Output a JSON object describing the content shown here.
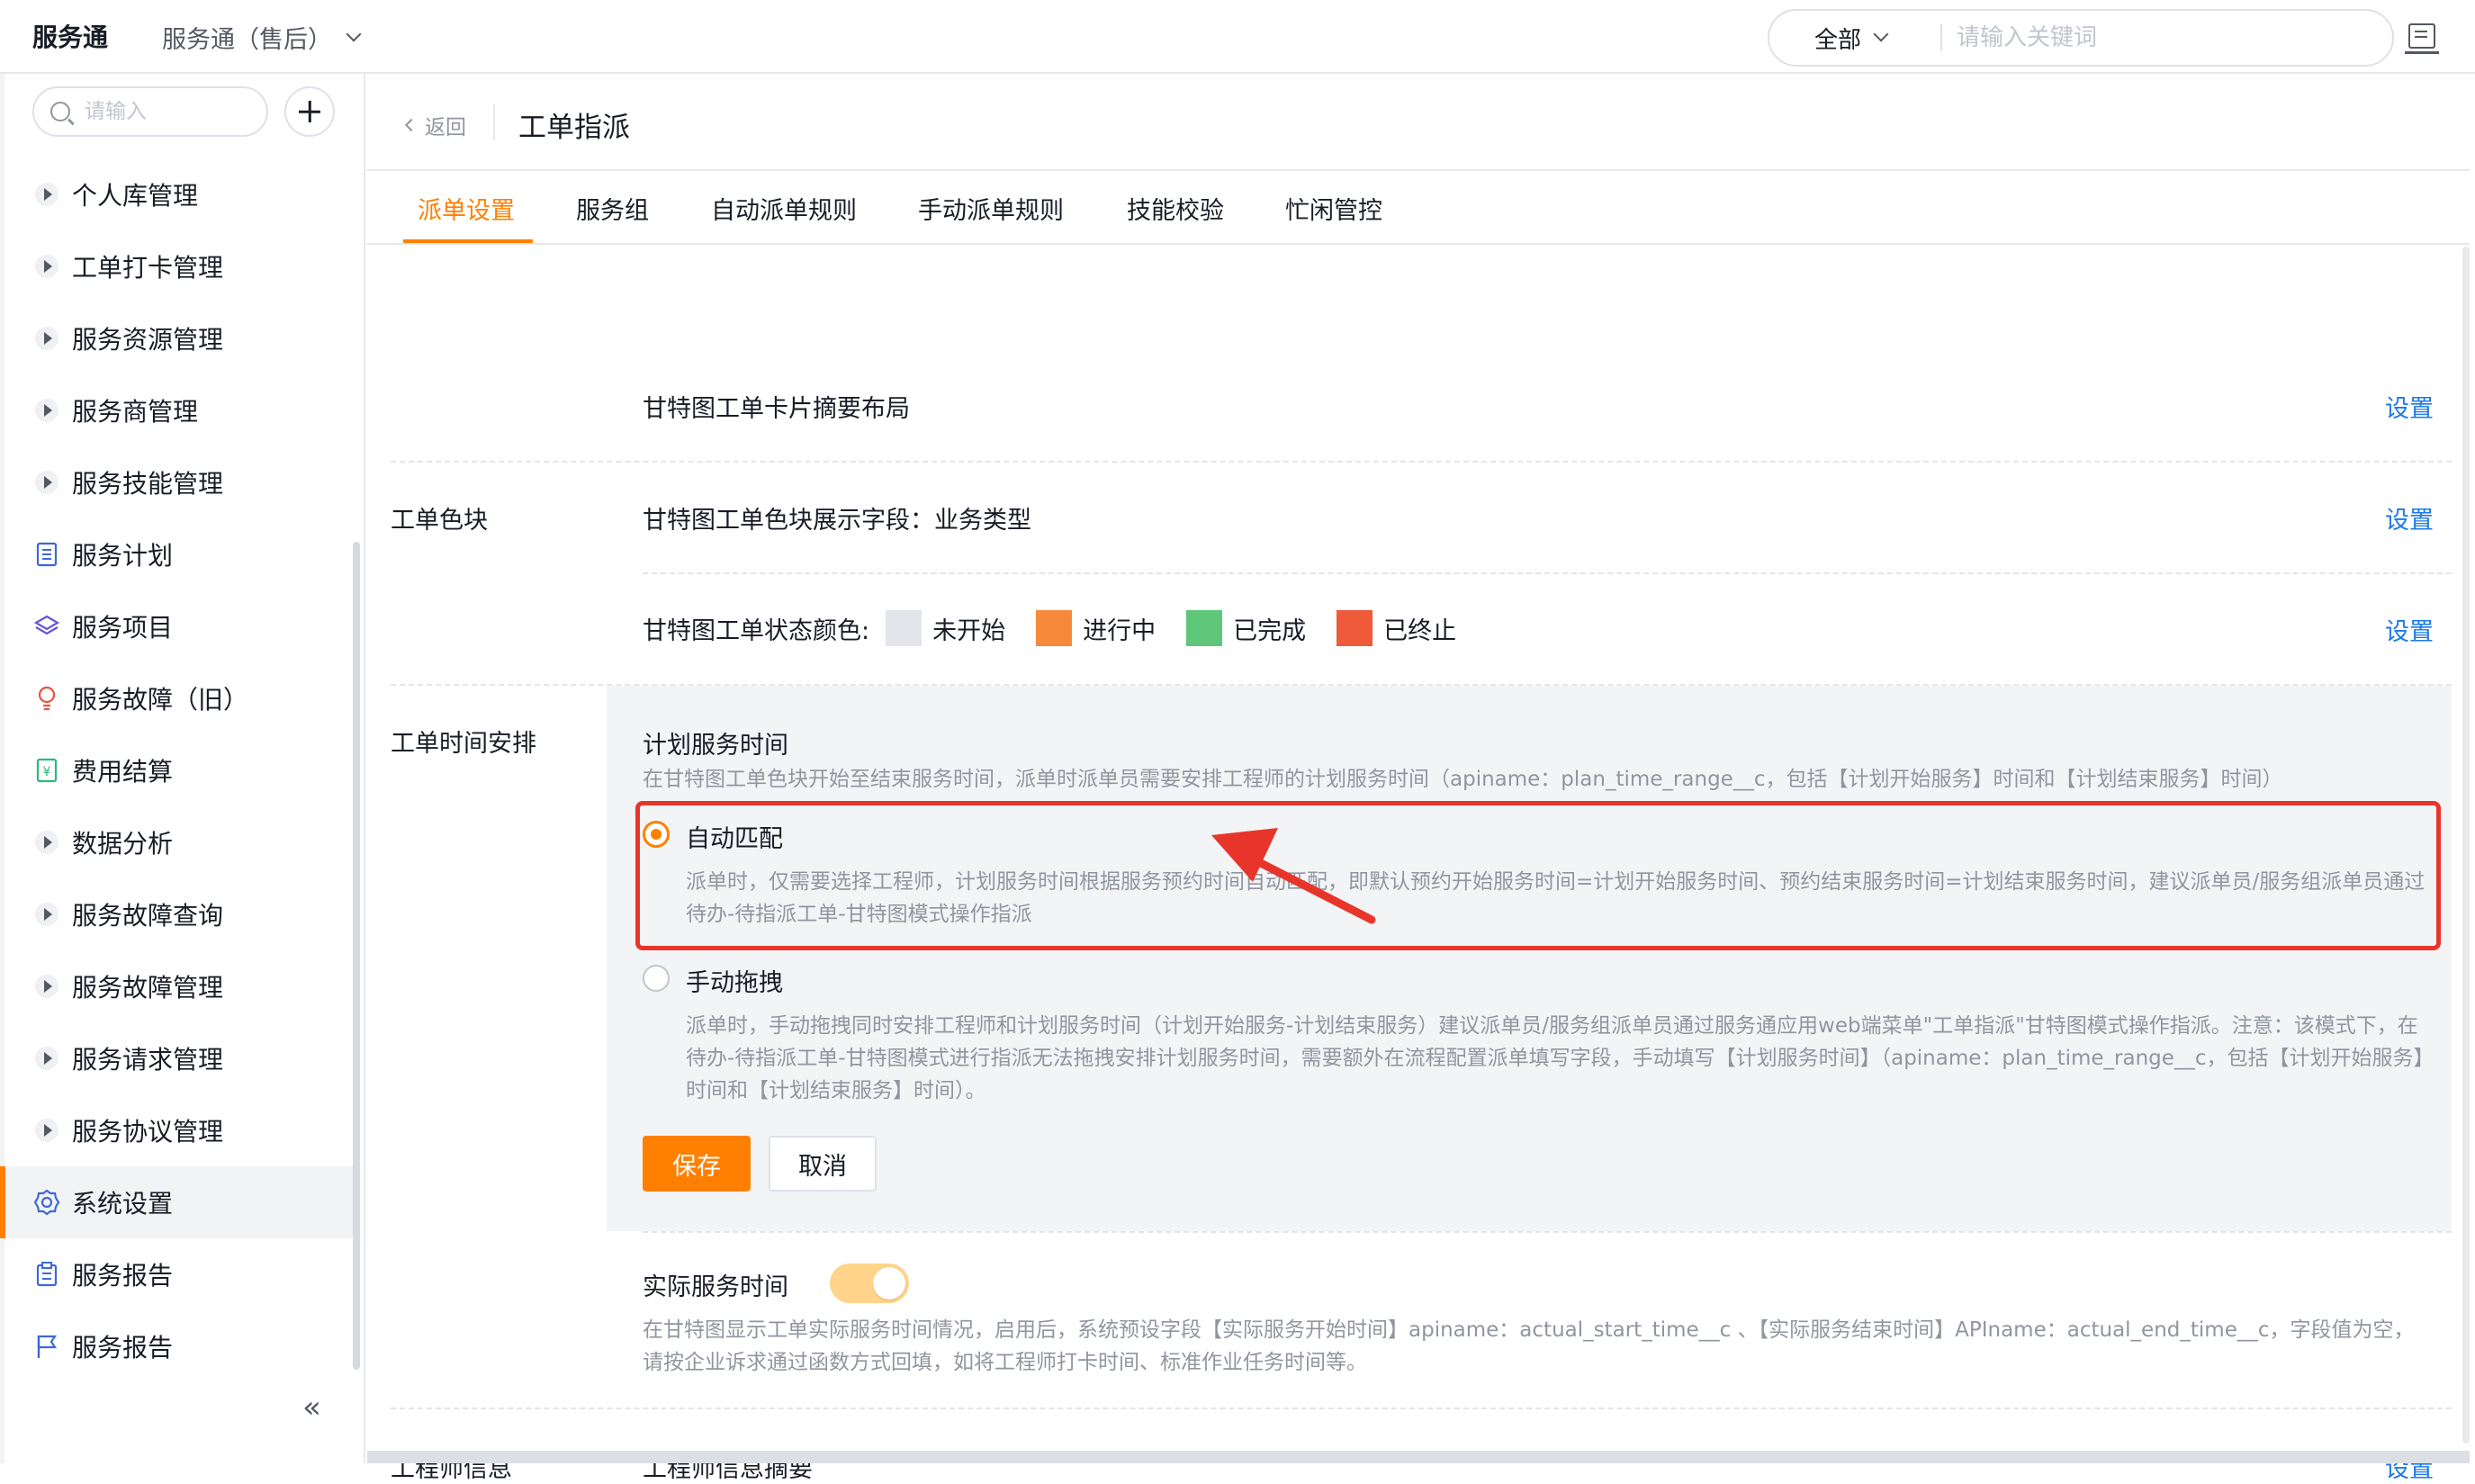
{
  "topbar": {
    "app_name": "服务通",
    "app_switch_label": "服务通（售后）",
    "search_scope": "全部",
    "search_placeholder": "请输入关键词"
  },
  "sidebar": {
    "search_placeholder": "请输入",
    "items": [
      {
        "label": "个人库管理",
        "icon": "caret-right-icon"
      },
      {
        "label": "工单打卡管理",
        "icon": "caret-right-icon"
      },
      {
        "label": "服务资源管理",
        "icon": "caret-right-icon"
      },
      {
        "label": "服务商管理",
        "icon": "caret-right-icon"
      },
      {
        "label": "服务技能管理",
        "icon": "caret-right-icon"
      },
      {
        "label": "服务计划",
        "icon": "list-icon"
      },
      {
        "label": "服务项目",
        "icon": "layers-icon"
      },
      {
        "label": "服务故障（旧）",
        "icon": "bulb-icon"
      },
      {
        "label": "费用结算",
        "icon": "yen-doc-icon"
      },
      {
        "label": "数据分析",
        "icon": "caret-right-icon"
      },
      {
        "label": "服务故障查询",
        "icon": "caret-right-icon"
      },
      {
        "label": "服务故障管理",
        "icon": "caret-right-icon"
      },
      {
        "label": "服务请求管理",
        "icon": "caret-right-icon"
      },
      {
        "label": "服务协议管理",
        "icon": "caret-right-icon"
      },
      {
        "label": "系统设置",
        "icon": "gear-icon",
        "active": true
      },
      {
        "label": "服务报告",
        "icon": "clipboard-icon"
      },
      {
        "label": "服务报告",
        "icon": "flag-icon"
      }
    ],
    "collapse_glyph": "«"
  },
  "header": {
    "back_label": "返回",
    "title": "工单指派"
  },
  "tabs": [
    {
      "label": "派单设置",
      "active": true
    },
    {
      "label": "服务组"
    },
    {
      "label": "自动派单规则"
    },
    {
      "label": "手动派单规则"
    },
    {
      "label": "技能校验"
    },
    {
      "label": "忙闲管控"
    }
  ],
  "settings": {
    "link_label": "设置",
    "gantt_card_layout": "甘特图工单卡片摘要布局",
    "color_block_label": "工单色块",
    "color_block_value": "甘特图工单色块展示字段：业务类型",
    "status_color_label": "甘特图工单状态颜色:",
    "status_colors": [
      {
        "name": "未开始",
        "color": "#e3e5ea"
      },
      {
        "name": "进行中",
        "color": "#f7893a"
      },
      {
        "name": "已完成",
        "color": "#5ec77a"
      },
      {
        "name": "已终止",
        "color": "#ee5a3a"
      }
    ],
    "time_label": "工单时间安排",
    "plan_time_title": "计划服务时间",
    "plan_time_desc": "在甘特图工单色块开始至结束服务时间，派单时派单员需要安排工程师的计划服务时间（apiname：plan_time_range__c，包括【计划开始服务】时间和【计划结束服务】时间）",
    "option_auto_label": "自动匹配",
    "option_auto_desc": "派单时，仅需要选择工程师，计划服务时间根据服务预约时间自动匹配，即默认预约开始服务时间=计划开始服务时间、预约结束服务时间=计划结束服务时间，建议派单员/服务组派单员通过待办-待指派工单-甘特图模式操作指派",
    "option_manual_label": "手动拖拽",
    "option_manual_desc": "派单时，手动拖拽同时安排工程师和计划服务时间（计划开始服务-计划结束服务）建议派单员/服务组派单员通过服务通应用web端菜单\"工单指派\"甘特图模式操作指派。注意：该模式下，在待办-待指派工单-甘特图模式进行指派无法拖拽安排计划服务时间，需要额外在流程配置派单填写字段，手动填写【计划服务时间】（apiname：plan_time_range__c，包括【计划开始服务】时间和【计划结束服务】时间）。",
    "selected_option": "自动匹配",
    "save_label": "保存",
    "cancel_label": "取消",
    "actual_time_title": "实际服务时间",
    "actual_time_enabled": true,
    "actual_time_desc": "在甘特图显示工单实际服务时间情况，启用后，系统预设字段【实际服务开始时间】apiname：actual_start_time__c 、【实际服务结束时间】APIname：actual_end_time__c，字段值为空，请按企业诉求通过函数方式回填，如将工程师打卡时间、标准作业任务时间等。",
    "engineer_label": "工程师信息",
    "engineer_value": "工程师信息摘要"
  },
  "colors": {
    "accent": "#ff8000",
    "link": "#1c7ae6",
    "highlight": "#e8352b"
  }
}
